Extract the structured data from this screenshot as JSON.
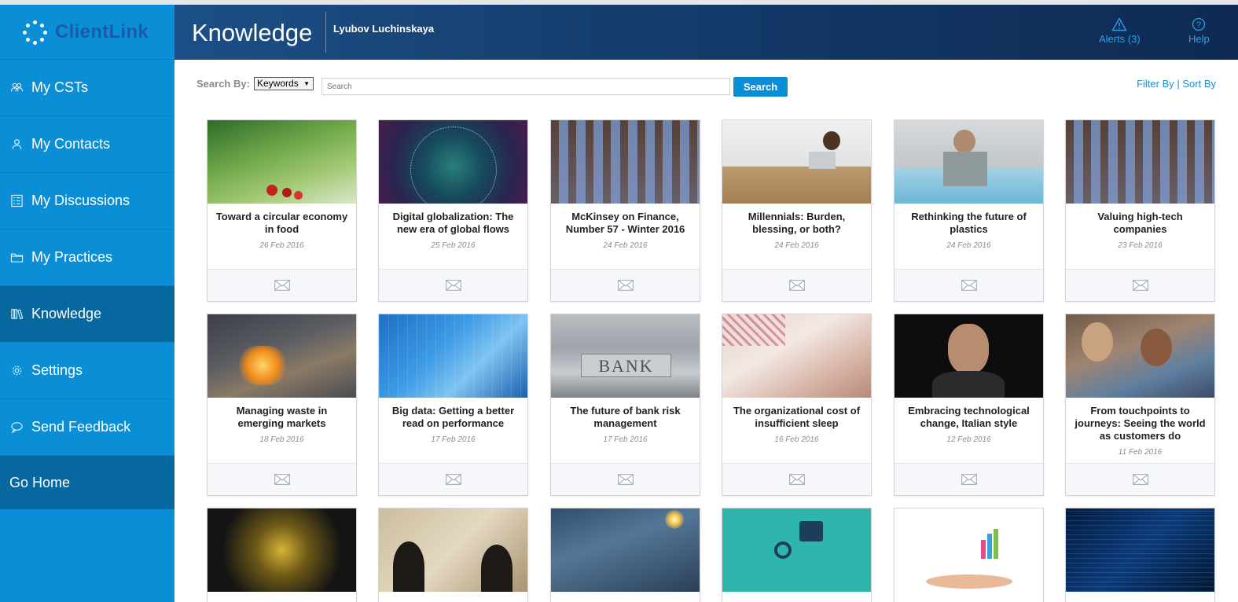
{
  "app": {
    "logo_text": "ClientLink"
  },
  "header": {
    "title": "Knowledge",
    "user": "Lyubov Luchinskaya",
    "alerts_label": "Alerts (3)",
    "help_label": "Help"
  },
  "sidebar": {
    "items": [
      {
        "label": "My CSTs",
        "icon": "people-icon"
      },
      {
        "label": "My Contacts",
        "icon": "person-icon"
      },
      {
        "label": "My Discussions",
        "icon": "checklist-icon"
      },
      {
        "label": "My Practices",
        "icon": "folder-icon"
      },
      {
        "label": "Knowledge",
        "icon": "books-icon",
        "active": true
      },
      {
        "label": "Settings",
        "icon": "gear-icon"
      },
      {
        "label": "Send Feedback",
        "icon": "chat-bubble-icon"
      }
    ],
    "home_label": "Go Home"
  },
  "search": {
    "label": "Search By:",
    "mode": "Keywords",
    "placeholder": "Search",
    "button": "Search",
    "filter_label": "Filter By",
    "separator": "|",
    "sort_label": "Sort By"
  },
  "articles": [
    {
      "title": "Toward a circular economy in food",
      "date": "26 Feb 2016"
    },
    {
      "title": "Digital globalization: The new era of global flows",
      "date": "25 Feb 2016"
    },
    {
      "title": "McKinsey on Finance, Number 57 - Winter 2016",
      "date": "24 Feb 2016"
    },
    {
      "title": "Millennials: Burden, blessing, or both?",
      "date": "24 Feb 2016"
    },
    {
      "title": "Rethinking the future of plastics",
      "date": "24 Feb 2016"
    },
    {
      "title": "Valuing high-tech companies",
      "date": "23 Feb 2016"
    },
    {
      "title": "Managing waste in emerging markets",
      "date": "18 Feb 2016"
    },
    {
      "title": "Big data: Getting a better read on performance",
      "date": "17 Feb 2016"
    },
    {
      "title": "The future of bank risk management",
      "date": "17 Feb 2016",
      "image_text": "BANK"
    },
    {
      "title": "The organizational cost of insufficient sleep",
      "date": "16 Feb 2016"
    },
    {
      "title": "Embracing technological change, Italian style",
      "date": "12 Feb 2016"
    },
    {
      "title": "From touchpoints to journeys: Seeing the world as customers do",
      "date": "11 Feb 2016"
    },
    {
      "title": "",
      "date": ""
    },
    {
      "title": "",
      "date": ""
    },
    {
      "title": "",
      "date": ""
    },
    {
      "title": "",
      "date": ""
    },
    {
      "title": "",
      "date": ""
    },
    {
      "title": "",
      "date": ""
    }
  ],
  "colors": {
    "sidebar": "#0a8fd6",
    "sidebar_active": "#07689f",
    "header_start": "#1c4f87",
    "header_end": "#0e2a52",
    "accent": "#1b8fd8"
  }
}
